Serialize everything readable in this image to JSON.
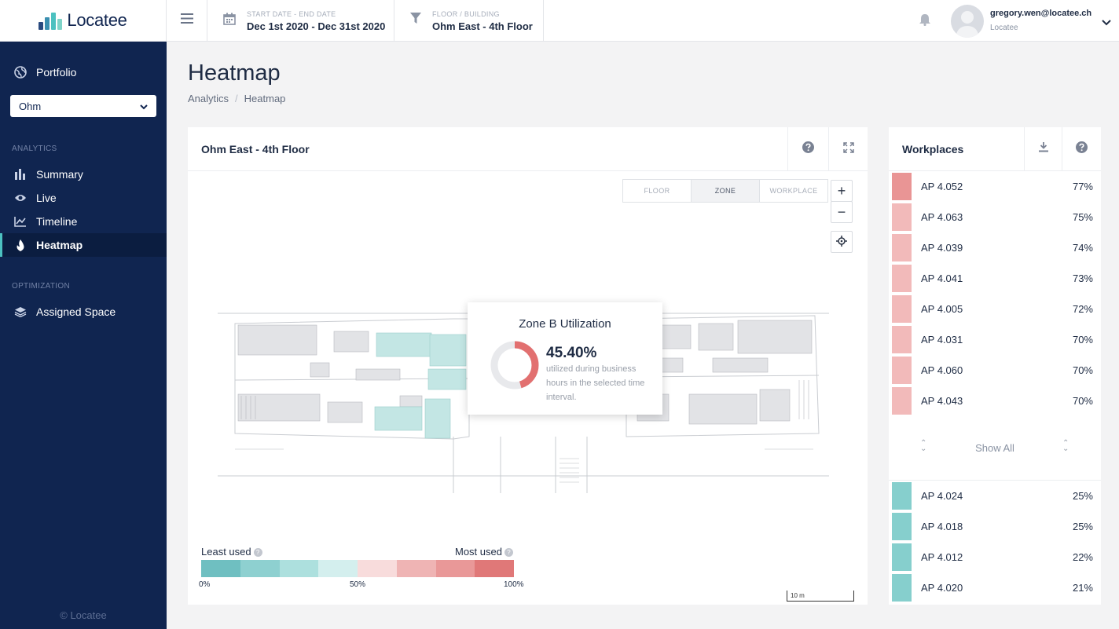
{
  "app": {
    "name": "Locatee",
    "copyright": "© Locatee"
  },
  "sidebar": {
    "portfolio_label": "Portfolio",
    "building_select": "Ohm",
    "sections": [
      {
        "label": "ANALYTICS",
        "items": [
          "Summary",
          "Live",
          "Timeline",
          "Heatmap"
        ]
      },
      {
        "label": "OPTIMIZATION",
        "items": [
          "Assigned Space"
        ]
      }
    ],
    "active_item": "Heatmap",
    "accent_color": "#4cc1c0"
  },
  "topbar": {
    "date_label": "START DATE - END DATE",
    "date_value": "Dec 1st 2020 - Dec 31st 2020",
    "floor_label": "FLOOR / BUILDING",
    "floor_value": "Ohm East - 4th Floor",
    "user_email": "gregory.wen@locatee.ch",
    "user_org": "Locatee"
  },
  "page": {
    "title": "Heatmap",
    "breadcrumb": [
      "Analytics",
      "Heatmap"
    ]
  },
  "map": {
    "title": "Ohm East - 4th Floor",
    "view_modes": [
      "FLOOR",
      "ZONE",
      "WORKPLACE"
    ],
    "active_mode": "ZONE",
    "zoom_in": "+",
    "zoom_out": "−",
    "popup": {
      "title": "Zone B Utilization",
      "value": "45.40%",
      "utilization": 45.4,
      "description": "utilized during business hours in the selected time interval."
    },
    "legend": {
      "least": "Least used",
      "most": "Most used",
      "tick_0": "0%",
      "tick_50": "50%",
      "tick_100": "100%",
      "colors": [
        "#6fbfc1",
        "#8ed0d0",
        "#ade0de",
        "#d4efee",
        "#f8dcdc",
        "#efb4b4",
        "#e99898",
        "#e07878"
      ]
    },
    "scale": "10 m"
  },
  "workplaces": {
    "title": "Workplaces",
    "top": [
      {
        "name": "AP 4.052",
        "pct": "77%",
        "color": "#e99595"
      },
      {
        "name": "AP 4.063",
        "pct": "75%",
        "color": "#f2baba"
      },
      {
        "name": "AP 4.039",
        "pct": "74%",
        "color": "#f2baba"
      },
      {
        "name": "AP 4.041",
        "pct": "73%",
        "color": "#f2baba"
      },
      {
        "name": "AP 4.005",
        "pct": "72%",
        "color": "#f2baba"
      },
      {
        "name": "AP 4.031",
        "pct": "70%",
        "color": "#f2baba"
      },
      {
        "name": "AP 4.060",
        "pct": "70%",
        "color": "#f2baba"
      },
      {
        "name": "AP 4.043",
        "pct": "70%",
        "color": "#f2baba"
      }
    ],
    "show_all": "Show All",
    "bottom": [
      {
        "name": "AP 4.024",
        "pct": "25%",
        "color": "#86cfcd"
      },
      {
        "name": "AP 4.018",
        "pct": "25%",
        "color": "#86cfcd"
      },
      {
        "name": "AP 4.012",
        "pct": "22%",
        "color": "#86cfcd"
      },
      {
        "name": "AP 4.020",
        "pct": "21%",
        "color": "#86cfcd"
      }
    ]
  }
}
